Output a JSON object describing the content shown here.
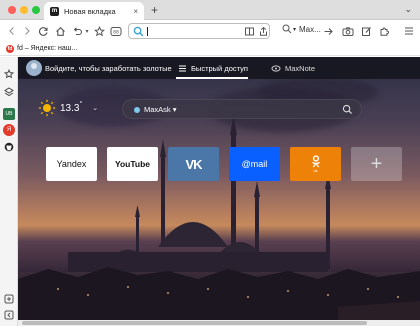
{
  "colors": {
    "tab_bar": "#dedede",
    "traffic_red": "#fe5f57",
    "traffic_yellow": "#febc2e",
    "traffic_green": "#28c840",
    "vk_blue": "#4a76a8",
    "mail_blue": "#0a5fff",
    "ok_orange": "#ee8208"
  },
  "tabs": [
    {
      "title": "Новая вкладка",
      "icon": "maxthon-icon",
      "close": "×"
    }
  ],
  "tab_bar": {
    "new_tab": "+",
    "menu_icon": "⌄"
  },
  "toolbar": {
    "address_value": "",
    "search_engine_label": "Max..."
  },
  "bookmarks": [
    {
      "icon_text": "fd",
      "label": "fd – Яндекс: наш..."
    }
  ],
  "newtab": {
    "login_text": "Войдите, чтобы заработать золотые",
    "tabs": [
      {
        "label": "Быстрый доступ",
        "icon": "grid-icon",
        "active": true
      },
      {
        "label": "MaxNote",
        "icon": "note-icon",
        "active": false
      }
    ],
    "weather": {
      "temperature": "13.3",
      "unit": "°"
    },
    "search": {
      "engine": "MaxAsk ▾"
    },
    "speed_dial": [
      {
        "name": "Yandex",
        "label": "Yandex",
        "bg": "#ffffff",
        "fg": "#111111"
      },
      {
        "name": "YouTube",
        "label": "YouTube",
        "bg": "#ffffff",
        "fg": "#111111"
      },
      {
        "name": "VK",
        "label": "VK",
        "bg": "#4a76a8",
        "fg": "#ffffff"
      },
      {
        "name": "Mail",
        "label": "@mail",
        "bg": "#0a5fff",
        "fg": "#ffffff"
      },
      {
        "name": "OK",
        "label": "ok",
        "bg": "#ee8208",
        "fg": "#ffffff"
      },
      {
        "name": "Add",
        "label": "+",
        "bg": "rgba(255,255,255,0.25)",
        "fg": "#dddddd"
      }
    ]
  }
}
